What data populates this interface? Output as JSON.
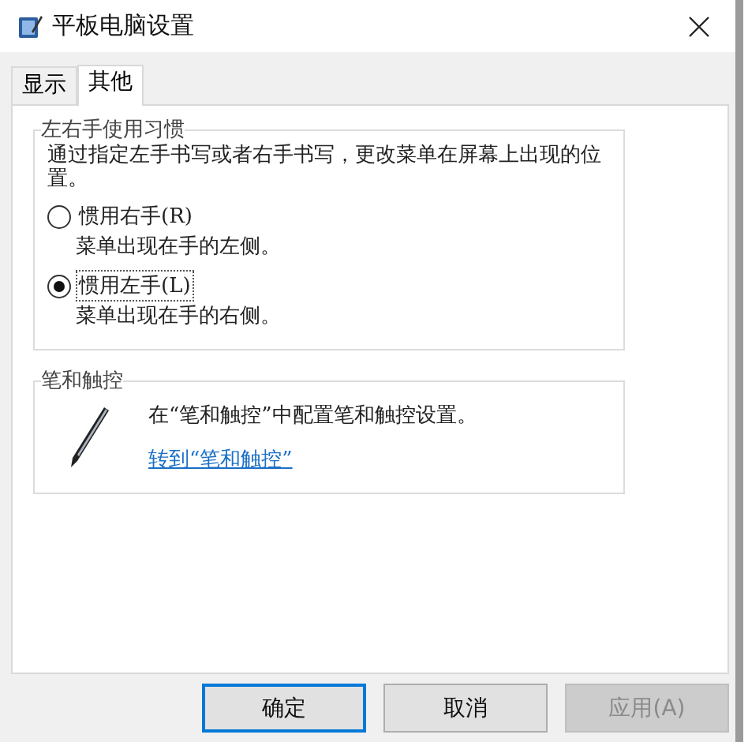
{
  "window": {
    "title": "平板电脑设置"
  },
  "tabs": [
    {
      "label": "显示",
      "selected": false
    },
    {
      "label": "其他",
      "selected": true
    }
  ],
  "handedness": {
    "title": "左右手使用习惯",
    "description": "通过指定左手书写或者右手书写，更改菜单在屏幕上出现的位置。",
    "options": [
      {
        "label": "惯用右手(R)",
        "note": "菜单出现在手的左侧。",
        "selected": false
      },
      {
        "label": "惯用左手(L)",
        "note": "菜单出现在手的右侧。",
        "selected": true
      }
    ]
  },
  "pen_touch": {
    "title": "笔和触控",
    "description": "在“笔和触控”中配置笔和触控设置。",
    "link": "转到“笔和触控”"
  },
  "buttons": [
    {
      "label": "确定",
      "kind": "default"
    },
    {
      "label": "取消",
      "kind": "normal"
    },
    {
      "label": "应用(A)",
      "kind": "disabled"
    }
  ]
}
